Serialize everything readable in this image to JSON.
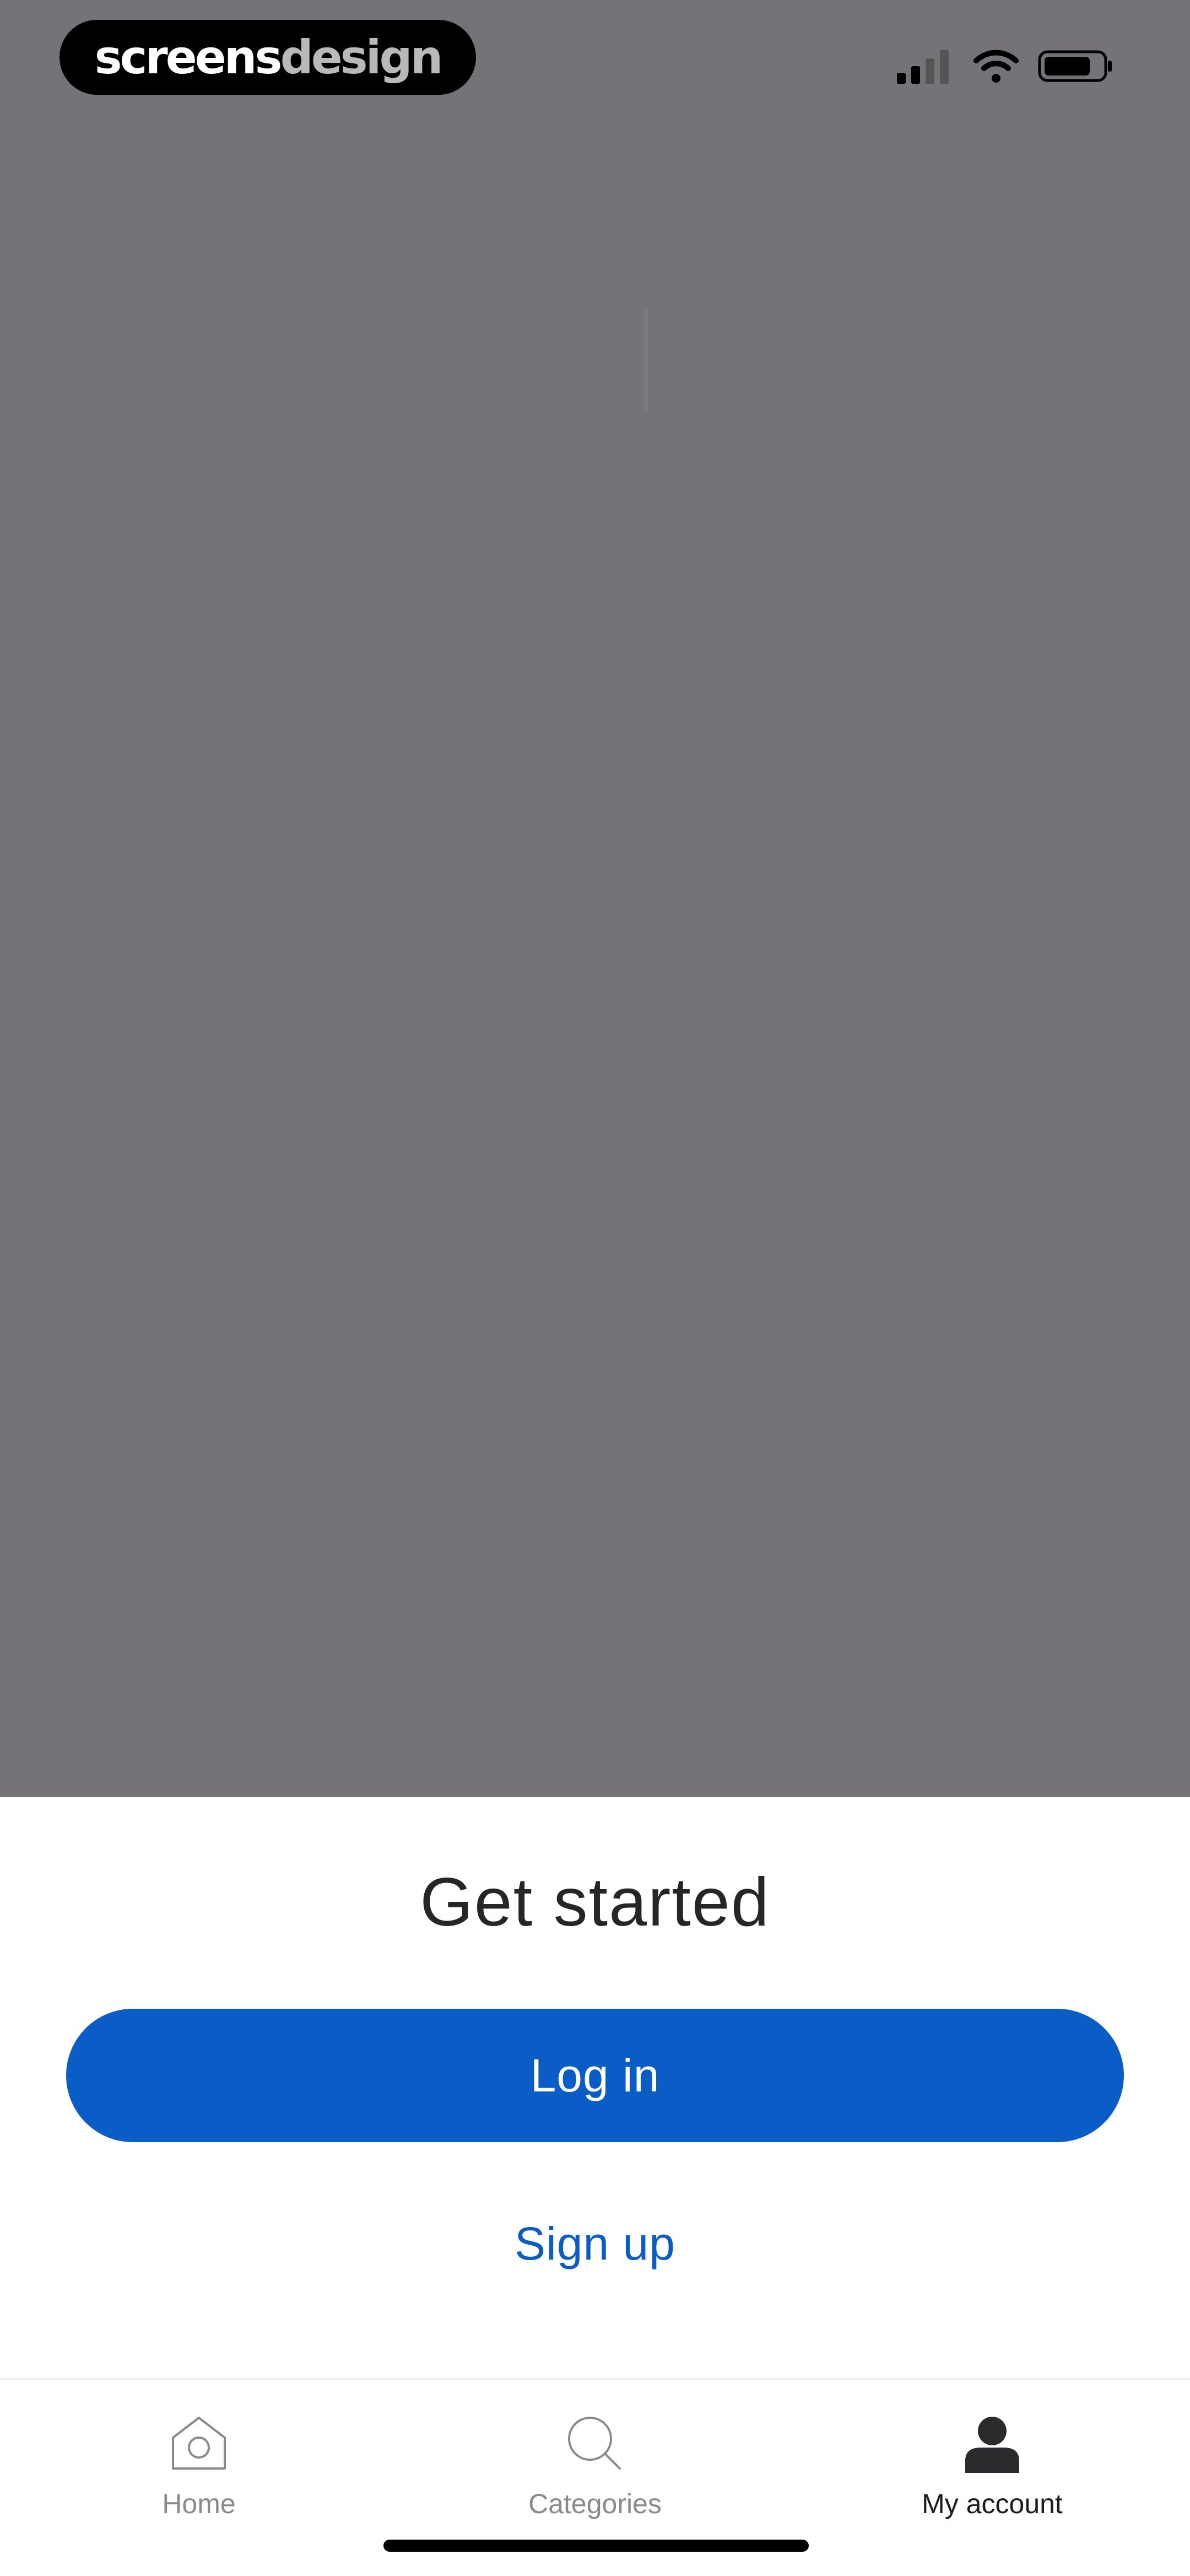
{
  "branding": {
    "part_a": "screens",
    "part_b": "design"
  },
  "status_bar": {
    "icons": [
      "cellular-signal-icon",
      "wifi-icon",
      "battery-icon"
    ]
  },
  "sheet": {
    "title": "Get started",
    "login_label": "Log in",
    "signup_label": "Sign up"
  },
  "tabbar": {
    "items": [
      {
        "label": "Home",
        "icon": "home-icon",
        "active": false
      },
      {
        "label": "Categories",
        "icon": "search-icon",
        "active": false
      },
      {
        "label": "My account",
        "icon": "person-icon",
        "active": true
      }
    ]
  },
  "colors": {
    "overlay": "#757377",
    "primary": "#0A5CC6",
    "inactive_tab": "#8A8A8E",
    "active_tab": "#1C1C1E"
  }
}
